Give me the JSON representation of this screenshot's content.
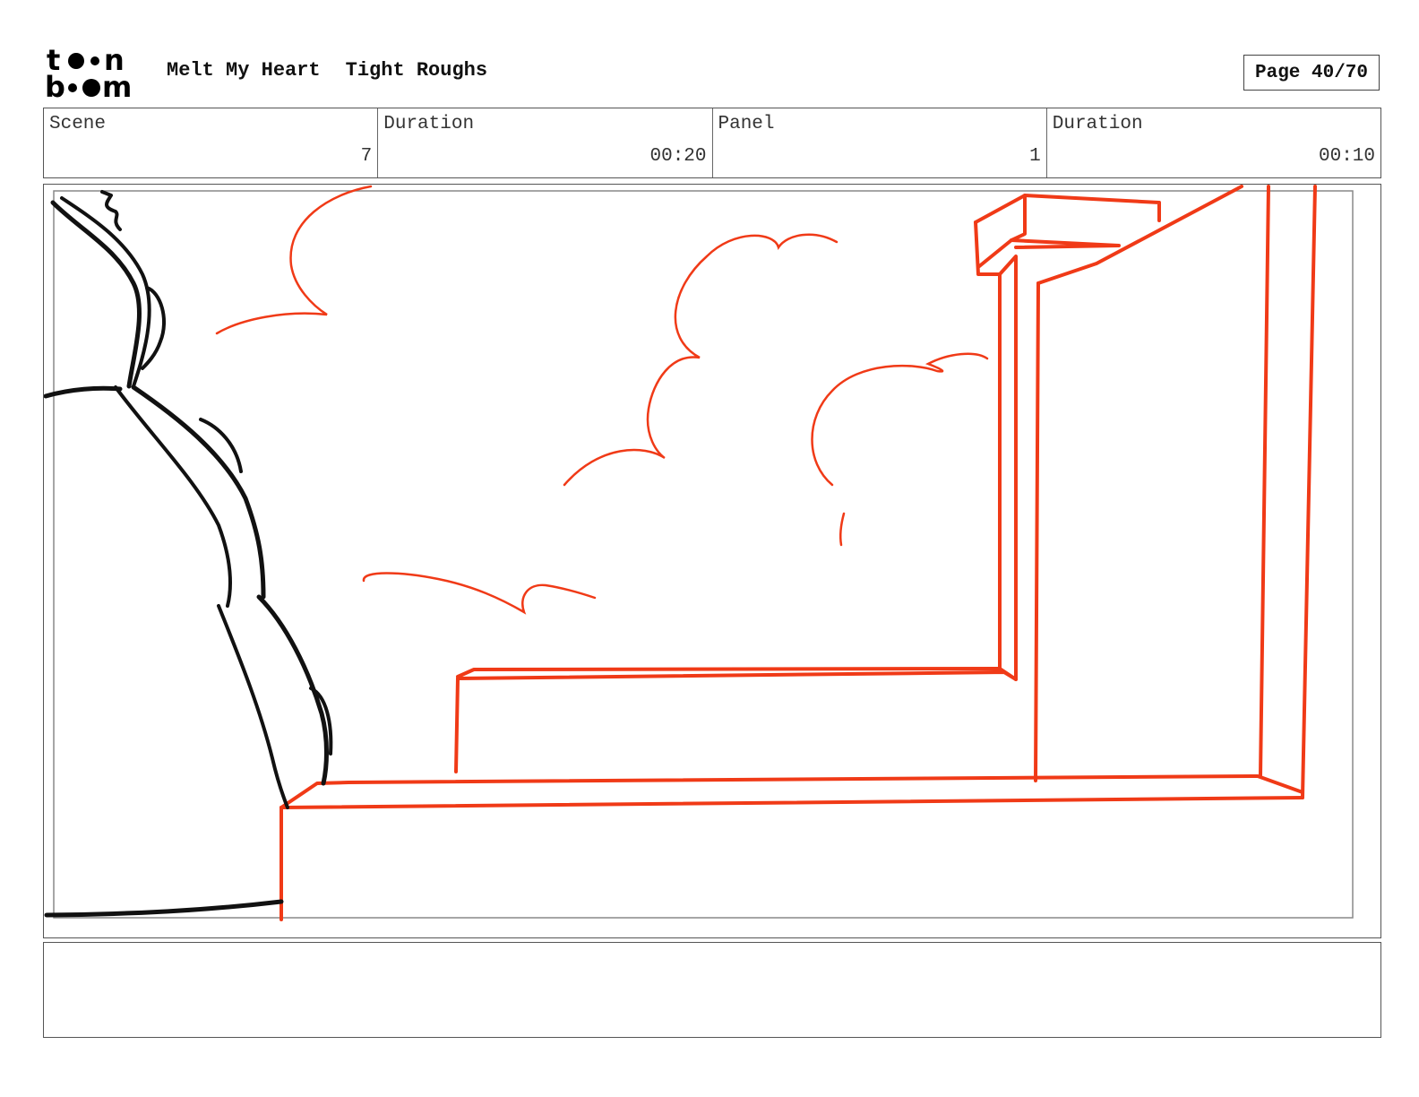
{
  "header": {
    "logo_text_top": "toon",
    "logo_text_bottom": "boom",
    "project_title": "Melt My Heart",
    "draft_label": "Tight Roughs",
    "page_indicator": "Page 40/70"
  },
  "info": {
    "scene_label": "Scene",
    "scene_value": "7",
    "scene_duration_label": "Duration",
    "scene_duration_value": "00:20",
    "panel_label": "Panel",
    "panel_value": "1",
    "panel_duration_label": "Duration",
    "panel_duration_value": "00:10"
  },
  "panel": {
    "description": "",
    "colors": {
      "rough_red": "#f03a17",
      "ink_black": "#111111"
    }
  },
  "notes": {
    "text": ""
  }
}
